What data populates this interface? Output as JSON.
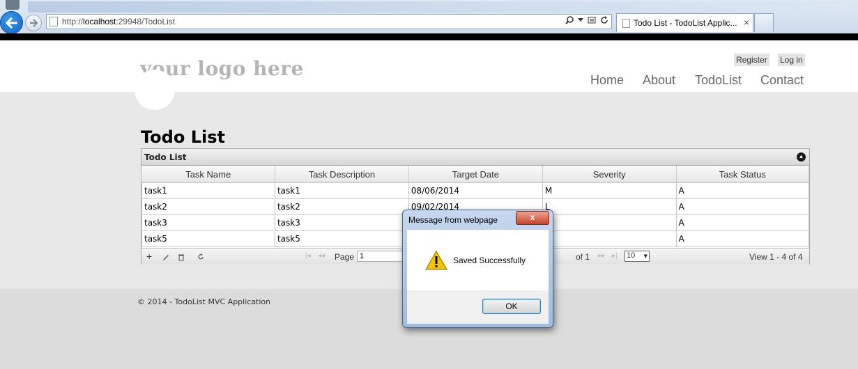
{
  "browser": {
    "url_prefix": "http://",
    "url_host": "localhost",
    "url_rest": ":29948/TodoList",
    "tab_title": "Todo List - TodoList Applic...",
    "tab_close": "×"
  },
  "site": {
    "logo": "your logo here",
    "register": "Register",
    "login": "Log in",
    "nav": [
      "Home",
      "About",
      "TodoList",
      "Contact"
    ],
    "footer": "© 2014 - TodoList MVC Application"
  },
  "page": {
    "title": "Todo List"
  },
  "grid": {
    "caption": "Todo List",
    "columns": [
      "Task Name",
      "Task Description",
      "Target Date",
      "Severity",
      "Task Status"
    ],
    "rows": [
      [
        "task1",
        "task1",
        "08/06/2014",
        "M",
        "A"
      ],
      [
        "task2",
        "task2",
        "09/02/2014",
        "L",
        "A"
      ],
      [
        "task3",
        "task3",
        "",
        "",
        "A"
      ],
      [
        "task5",
        "task5",
        "",
        "",
        "A"
      ]
    ],
    "pager": {
      "page_label": "Page",
      "page_value": "1",
      "of_label": "of 1",
      "rows_per_page": "10",
      "records": "View 1 - 4 of 4"
    }
  },
  "dialog": {
    "title": "Message from webpage",
    "close": "x",
    "message": "Saved Successfully",
    "ok": "OK"
  },
  "colors": {
    "page_bg": "#e8e8e8",
    "dialog_frame": "#a8c2e4",
    "warning": "#f5c400"
  }
}
